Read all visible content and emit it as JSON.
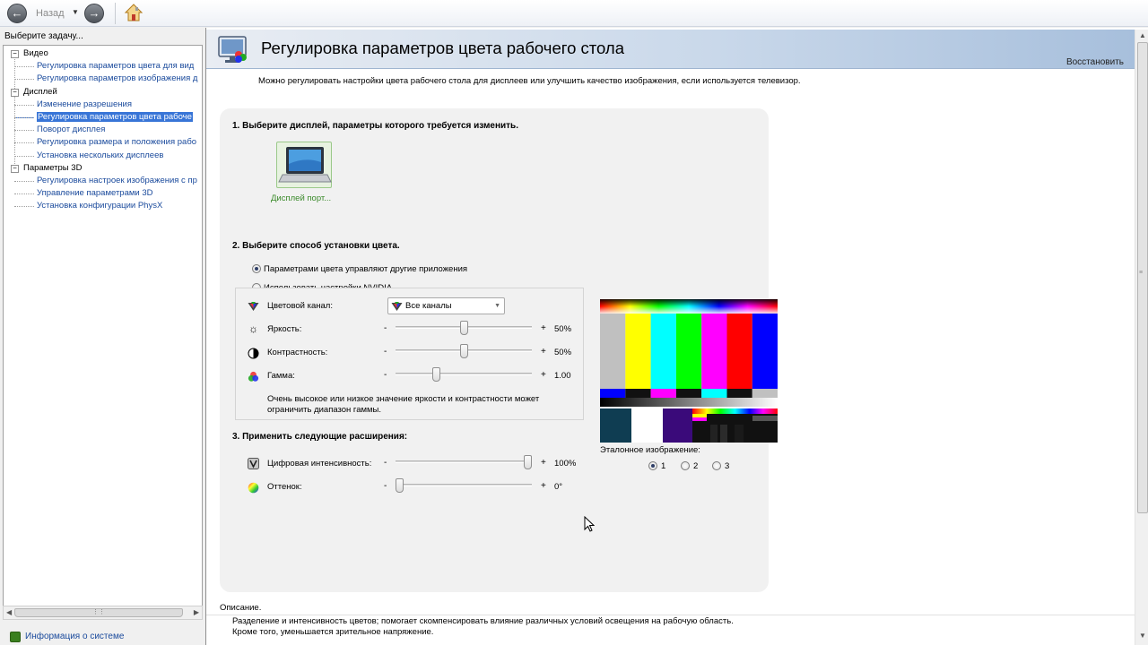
{
  "toolbar": {
    "back_label": "Назад"
  },
  "left": {
    "header": "Выберите задачу...",
    "tree": [
      {
        "label": "Видео",
        "kind": "group"
      },
      {
        "label": "Регулировка параметров цвета для вид",
        "kind": "child"
      },
      {
        "label": "Регулировка параметров изображения д",
        "kind": "child"
      },
      {
        "label": "Дисплей",
        "kind": "group"
      },
      {
        "label": "Изменение разрешения",
        "kind": "child"
      },
      {
        "label": "Регулировка параметров цвета рабоче",
        "kind": "child",
        "selected": true
      },
      {
        "label": "Поворот дисплея",
        "kind": "child"
      },
      {
        "label": "Регулировка размера и положения рабо",
        "kind": "child"
      },
      {
        "label": "Установка нескольких дисплеев",
        "kind": "child"
      },
      {
        "label": "Параметры 3D",
        "kind": "group"
      },
      {
        "label": "Регулировка настроек изображения с пр",
        "kind": "child"
      },
      {
        "label": "Управление параметрами 3D",
        "kind": "child"
      },
      {
        "label": "Установка конфигурации PhysX",
        "kind": "child"
      }
    ],
    "sysinfo": "Информация о системе"
  },
  "main": {
    "title": "Регулировка параметров цвета рабочего стола",
    "restore": "Восстановить",
    "intro": "Можно регулировать настройки цвета рабочего стола для дисплеев или улучшить качество изображения, если используется телевизор.",
    "step1": "1. Выберите дисплей, параметры которого требуется изменить.",
    "display_label": "Дисплей порт...",
    "step2": "2. Выберите способ установки цвета.",
    "radio_other_apps": "Параметрами цвета управляют другие приложения",
    "radio_nvidia": "Использовать настройки NVIDIA",
    "channel_label": "Цветовой канал:",
    "channel_value": "Все каналы",
    "brightness": {
      "label": "Яркость:",
      "minus": "-",
      "plus": "+",
      "value": "50%",
      "level": 0.5
    },
    "contrast": {
      "label": "Контрастность:",
      "minus": "-",
      "plus": "+",
      "value": "50%",
      "level": 0.5
    },
    "gamma": {
      "label": "Гамма:",
      "minus": "-",
      "plus": "+",
      "value": "1.00",
      "level": 0.29
    },
    "note": "Очень высокое или низкое значение яркости и контрастности может ограничить диапазон гаммы.",
    "step3": "3. Применить следующие расширения:",
    "vibrance": {
      "label": "Цифровая интенсивность:",
      "minus": "-",
      "plus": "+",
      "value": "100%",
      "level": 1.0
    },
    "hue": {
      "label": "Оттенок:",
      "minus": "-",
      "plus": "+",
      "value": "0°",
      "level": 0.0
    },
    "ref_label": "Эталонное изображение:",
    "ref_options": [
      "1",
      "2",
      "3"
    ],
    "desc_label": "Описание.",
    "desc_line1": "Разделение и интенсивность цветов; помогает скомпенсировать влияние различных условий освещения на рабочую область.",
    "desc_line2": "Кроме того, уменьшается зрительное напряжение."
  },
  "colors": {
    "link": "#1a4a9c",
    "selection": "#3875d7",
    "display_label": "#3a8a2a"
  }
}
